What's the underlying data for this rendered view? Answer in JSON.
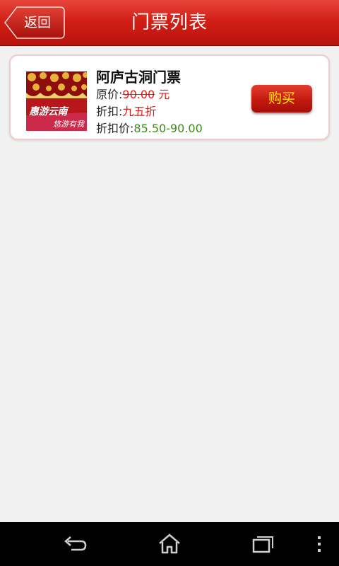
{
  "header": {
    "back_label": "返回",
    "title": "门票列表"
  },
  "ticket": {
    "name": "阿庐古洞门票",
    "original_price_label": "原价:",
    "original_price": "90.00",
    "currency": " 元",
    "discount_label": "折扣:",
    "discount": "九五折",
    "discount_price_label": "折扣价:",
    "discount_price": "85.50-90.00",
    "buy_label": "购买",
    "thumbnail": {
      "title": "惠游云南",
      "subtitle": "悠游有我"
    }
  },
  "navbar": {
    "items": [
      "back-icon",
      "home-icon",
      "recent-apps-icon",
      "menu-icon"
    ]
  },
  "colors": {
    "header_red": "#d21f16",
    "price_red": "#e41a14",
    "discount_price_green": "#3c8b1c",
    "buy_text_yellow": "#ffe600"
  }
}
